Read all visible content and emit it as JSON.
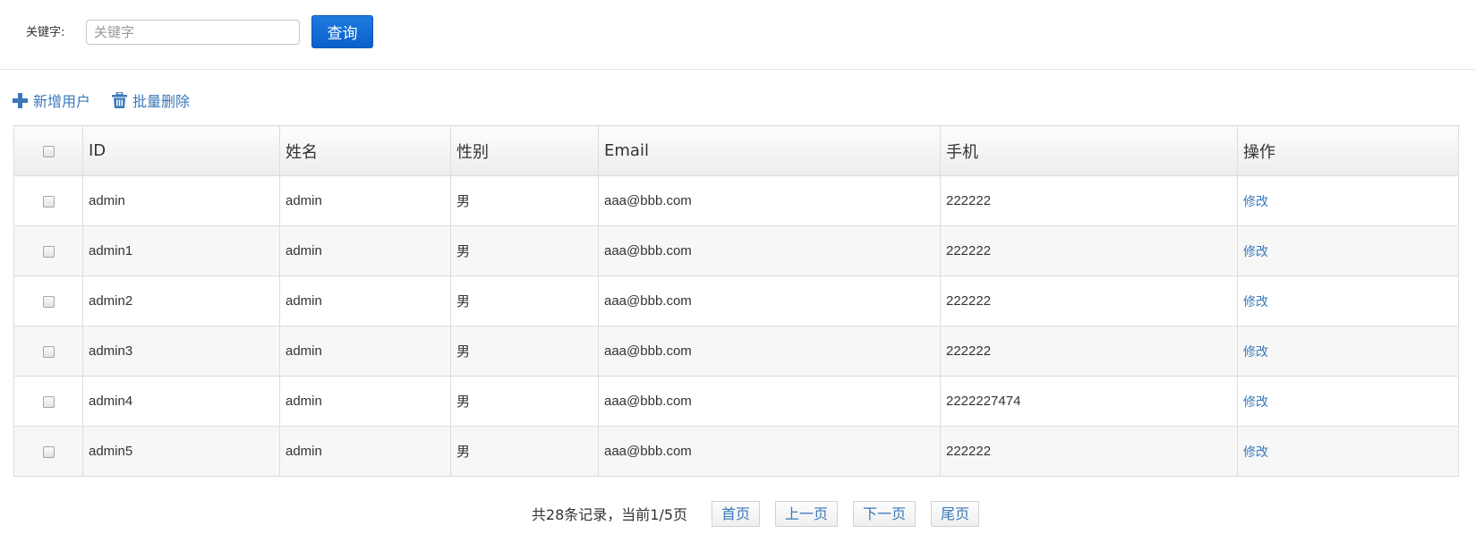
{
  "search": {
    "label": "关键字:",
    "placeholder": "关键字",
    "value": "",
    "button_label": "查询"
  },
  "toolbar": {
    "add_user_label": "新增用户",
    "batch_delete_label": "批量删除",
    "add_icon": "plus-icon",
    "delete_icon": "trash-icon",
    "link_color": "#3a78bb"
  },
  "table": {
    "headers": [
      "",
      "ID",
      "姓名",
      "性别",
      "Email",
      "手机",
      "操作"
    ],
    "rows": [
      {
        "id": "admin",
        "name": "admin",
        "gender": "男",
        "email": "aaa@bbb.com",
        "phone": "222222",
        "action": "修改"
      },
      {
        "id": "admin1",
        "name": "admin",
        "gender": "男",
        "email": "aaa@bbb.com",
        "phone": "222222",
        "action": "修改"
      },
      {
        "id": "admin2",
        "name": "admin",
        "gender": "男",
        "email": "aaa@bbb.com",
        "phone": "222222",
        "action": "修改"
      },
      {
        "id": "admin3",
        "name": "admin",
        "gender": "男",
        "email": "aaa@bbb.com",
        "phone": "222222",
        "action": "修改"
      },
      {
        "id": "admin4",
        "name": "admin",
        "gender": "男",
        "email": "aaa@bbb.com",
        "phone": "2222227474",
        "action": "修改"
      },
      {
        "id": "admin5",
        "name": "admin",
        "gender": "男",
        "email": "aaa@bbb.com",
        "phone": "222222",
        "action": "修改"
      }
    ]
  },
  "pagination": {
    "summary": "共28条记录，当前1/5页",
    "first_label": "首页",
    "prev_label": "上一页",
    "next_label": "下一页",
    "last_label": "尾页"
  }
}
